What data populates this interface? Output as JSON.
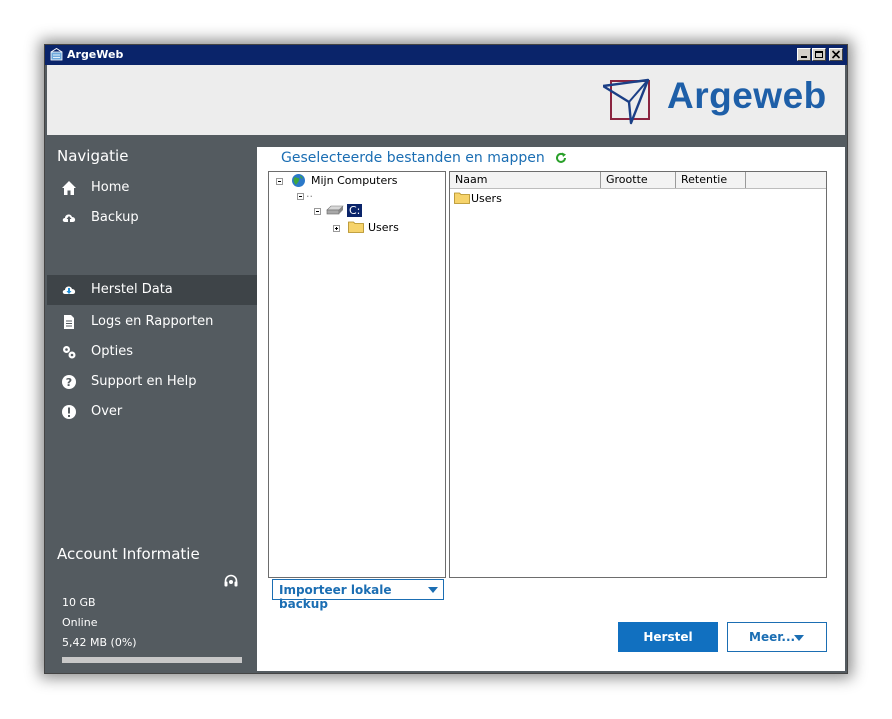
{
  "window": {
    "title": "ArgeWeb"
  },
  "brand": {
    "name": "Argeweb",
    "color": "#1e5fa8"
  },
  "sidebar": {
    "title": "Navigatie",
    "items": [
      {
        "label": "Home",
        "icon": "home-icon"
      },
      {
        "label": "Backup",
        "icon": "cloud-upload-icon"
      },
      {
        "label": "Herstel Data",
        "icon": "cloud-download-icon",
        "active": true
      },
      {
        "label": "Logs en Rapporten",
        "icon": "document-icon"
      },
      {
        "label": "Opties",
        "icon": "gears-icon"
      },
      {
        "label": "Support en Help",
        "icon": "help-icon"
      },
      {
        "label": "Over",
        "icon": "info-icon"
      }
    ],
    "account": {
      "title": "Account Informatie",
      "quota": "10 GB",
      "status": "Online",
      "used": "5,42 MB (0%)",
      "used_fraction": 0.0,
      "icon": "support-headset-icon"
    }
  },
  "main": {
    "title": "Geselecteerde bestanden en mappen",
    "refresh_icon": "refresh-icon",
    "tree": {
      "root": "Mijn Computers",
      "unnamed": "..",
      "drive": "C:",
      "folder": "Users"
    },
    "list": {
      "columns": [
        "Naam",
        "Grootte",
        "Retentie"
      ],
      "rows": [
        {
          "name": "Users"
        }
      ]
    },
    "import_button": "Importeer lokale backup",
    "restore_button": "Herstel",
    "more_button": "Meer..."
  },
  "colors": {
    "accent": "#1170c0",
    "sidebar_bg": "#545b60",
    "active_bg": "#3e4448",
    "titlebar": "#0a246a"
  }
}
